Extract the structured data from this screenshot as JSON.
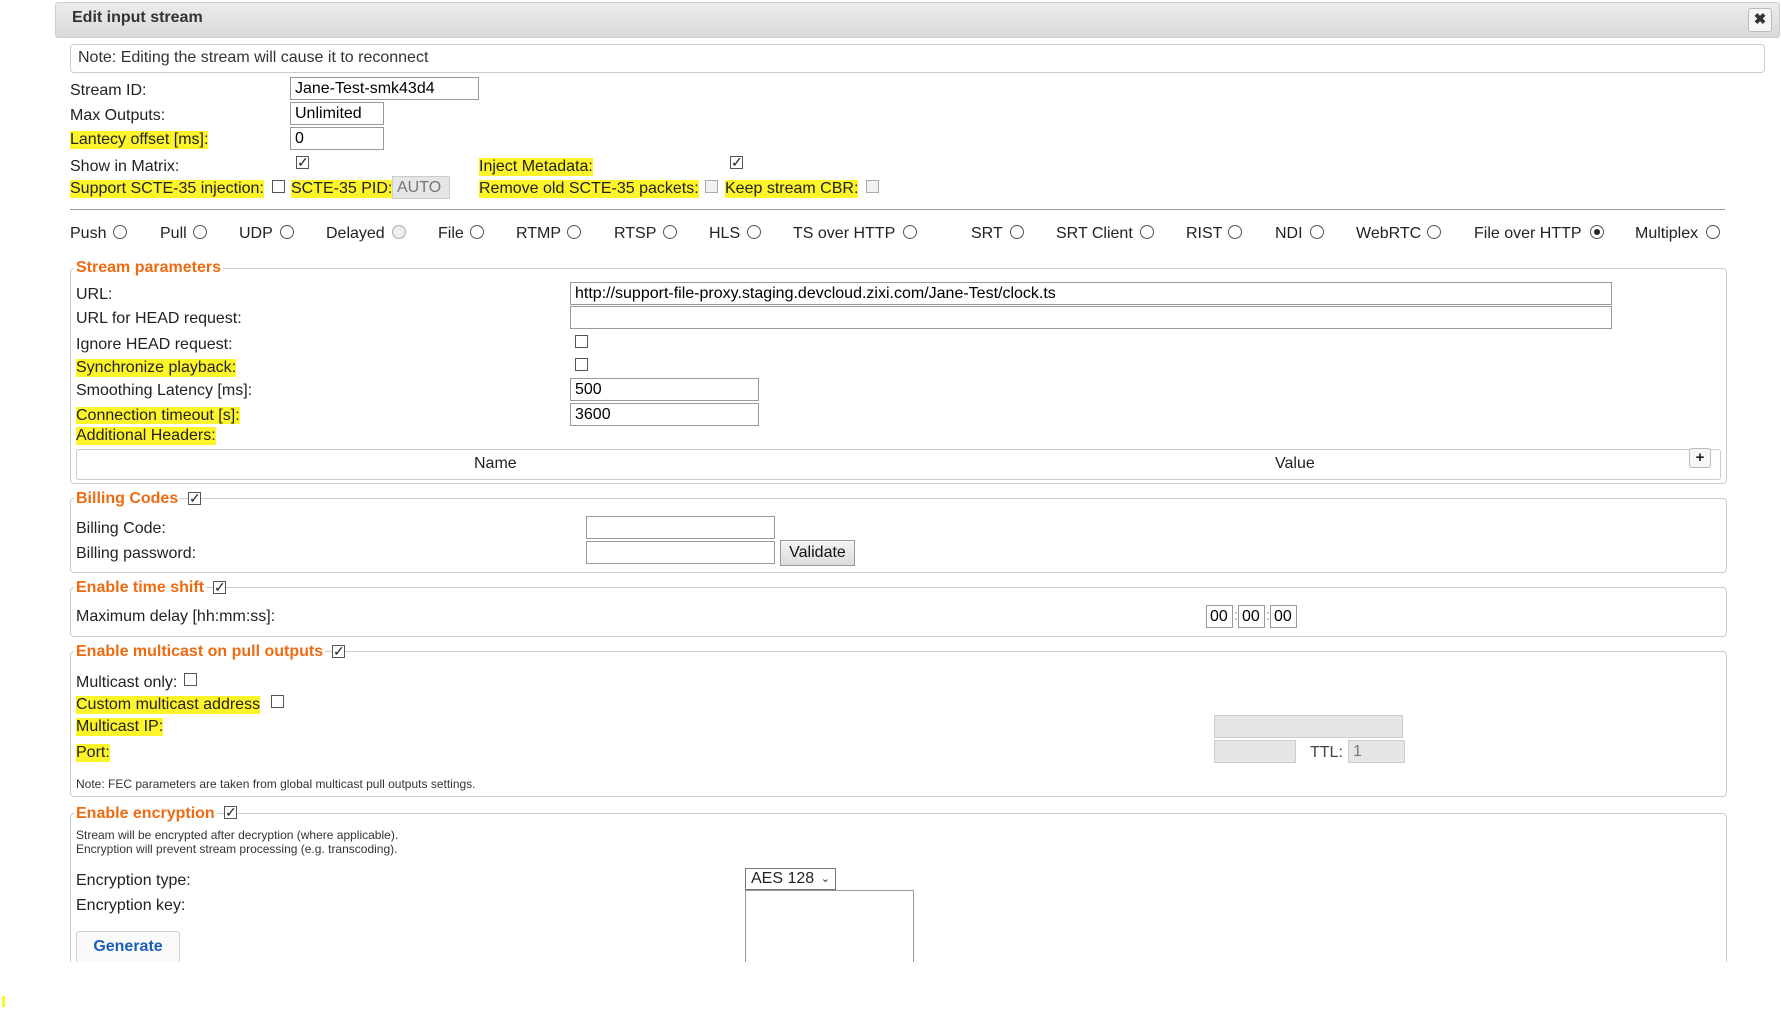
{
  "dialog": {
    "title": "Edit input stream",
    "close_symbol": "✖"
  },
  "note": "Note: Editing the stream will cause it to reconnect",
  "fields": {
    "stream_id_label": "Stream ID:",
    "stream_id_value": "Jane-Test-smk43d4",
    "max_outputs_label": "Max Outputs:",
    "max_outputs_value": "Unlimited",
    "latency_offset_label": "Lantecy offset [ms]:",
    "latency_offset_value": "0",
    "show_in_matrix_label": "Show in Matrix:",
    "show_in_matrix_checked": true,
    "inject_metadata_label": "Inject Metadata:",
    "inject_metadata_checked": true,
    "support_scte35_label": "Support SCTE-35 injection:",
    "support_scte35_checked": false,
    "scte35_pid_label": "SCTE-35 PID:",
    "scte35_pid_value": "AUTO",
    "remove_old_scte35_label": "Remove old SCTE-35 packets:",
    "keep_stream_cbr_label": "Keep stream CBR:"
  },
  "stream_types": [
    {
      "label": "Push",
      "selected": false,
      "disabled": false
    },
    {
      "label": "Pull",
      "selected": false,
      "disabled": false
    },
    {
      "label": "UDP",
      "selected": false,
      "disabled": false
    },
    {
      "label": "Delayed",
      "selected": false,
      "disabled": true
    },
    {
      "label": "File",
      "selected": false,
      "disabled": false
    },
    {
      "label": "RTMP",
      "selected": false,
      "disabled": false
    },
    {
      "label": "RTSP",
      "selected": false,
      "disabled": false
    },
    {
      "label": "HLS",
      "selected": false,
      "disabled": false
    },
    {
      "label": "TS over HTTP",
      "selected": false,
      "disabled": false
    },
    {
      "label": "SRT",
      "selected": false,
      "disabled": false
    },
    {
      "label": "SRT Client",
      "selected": false,
      "disabled": false
    },
    {
      "label": "RIST",
      "selected": false,
      "disabled": false
    },
    {
      "label": "NDI",
      "selected": false,
      "disabled": false
    },
    {
      "label": "WebRTC",
      "selected": false,
      "disabled": false
    },
    {
      "label": "File over HTTP",
      "selected": true,
      "disabled": false
    },
    {
      "label": "Multiplex",
      "selected": false,
      "disabled": false
    }
  ],
  "stream_parameters": {
    "legend": "Stream parameters",
    "url_label": "URL:",
    "url_value": "http://support-file-proxy.staging.devcloud.zixi.com/Jane-Test/clock.ts",
    "url_head_label": "URL for HEAD request:",
    "url_head_value": "",
    "ignore_head_label": "Ignore HEAD request:",
    "sync_playback_label": "Synchronize playback:",
    "smoothing_latency_label": "Smoothing Latency [ms]:",
    "smoothing_latency_value": "500",
    "connection_timeout_label": "Connection timeout [s]:",
    "connection_timeout_value": "3600",
    "additional_headers_label": "Additional Headers:",
    "headers_table": {
      "name_col": "Name",
      "value_col": "Value",
      "add_symbol": "+"
    }
  },
  "billing": {
    "legend": "Billing Codes",
    "checked": true,
    "code_label": "Billing Code:",
    "password_label": "Billing password:",
    "validate_label": "Validate"
  },
  "time_shift": {
    "legend": "Enable time shift",
    "checked": true,
    "max_delay_label": "Maximum delay [hh:mm:ss]:",
    "hh": "00",
    "mm": "00",
    "ss": "00",
    "sep": ":"
  },
  "multicast": {
    "legend": "Enable multicast on pull outputs",
    "checked": true,
    "multicast_only_label": "Multicast only:",
    "custom_address_label": "Custom multicast address",
    "multicast_ip_label": "Multicast IP:",
    "port_label": "Port:",
    "ttl_label": "TTL:",
    "ttl_value": "1",
    "fec_note": "Note: FEC parameters are taken from global multicast pull outputs settings."
  },
  "encryption": {
    "legend": "Enable encryption",
    "checked": true,
    "note_line1": "Stream will be encrypted after decryption (where applicable).",
    "note_line2": "Encryption will prevent stream processing (e.g. transcoding).",
    "type_label": "Encryption type:",
    "type_value": "AES 128",
    "key_label": "Encryption key:",
    "generate_label": "Generate"
  },
  "colors": {
    "highlight": "#fdf52a",
    "legend_orange": "#ee6b12",
    "link_blue": "#1a5fb4"
  }
}
